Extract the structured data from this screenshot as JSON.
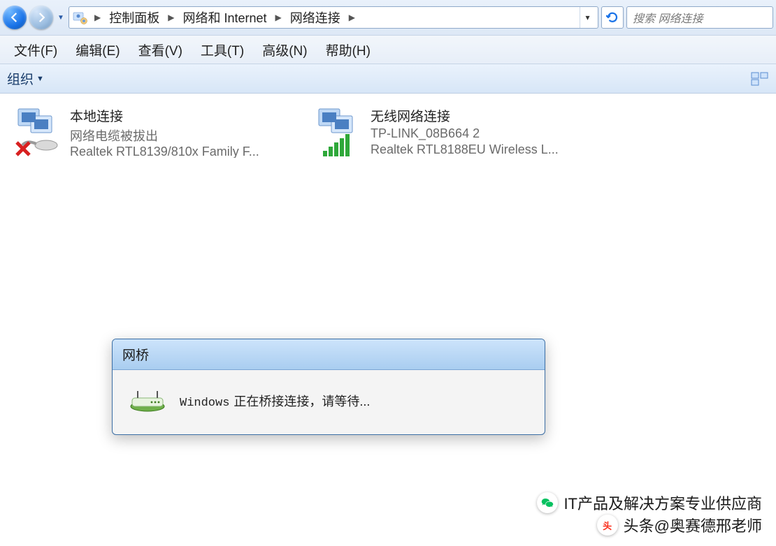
{
  "nav": {
    "breadcrumbs": [
      "控制面板",
      "网络和 Internet",
      "网络连接"
    ],
    "search_placeholder": "搜索 网络连接"
  },
  "menubar": {
    "items": [
      "文件(F)",
      "编辑(E)",
      "查看(V)",
      "工具(T)",
      "高级(N)",
      "帮助(H)"
    ]
  },
  "toolbar": {
    "organize_label": "组织"
  },
  "connections": [
    {
      "title": "本地连接",
      "status": "网络电缆被拔出",
      "adapter": "Realtek RTL8139/810x Family F..."
    },
    {
      "title": "无线网络连接",
      "status": "TP-LINK_08B664  2",
      "adapter": "Realtek RTL8188EU Wireless L..."
    }
  ],
  "dialog": {
    "title": "网桥",
    "app_name": "Windows",
    "message": "正在桥接连接，请等待..."
  },
  "watermarks": {
    "line1": "IT产品及解决方案专业供应商",
    "line2": "头条@奥赛德邢老师"
  }
}
